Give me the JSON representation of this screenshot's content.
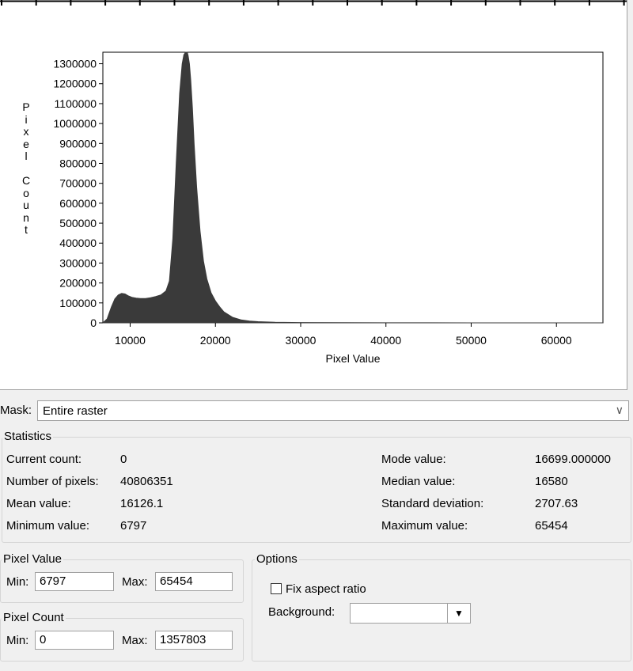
{
  "chart_data": {
    "type": "area",
    "title": "",
    "xlabel": "Pixel Value",
    "ylabel": "Pixel Count",
    "xlim": [
      6797,
      65454
    ],
    "ylim": [
      0,
      1357803
    ],
    "x_ticks": [
      "10000",
      "20000",
      "30000",
      "40000",
      "50000",
      "60000"
    ],
    "y_ticks": [
      "0",
      "100000",
      "200000",
      "300000",
      "400000",
      "500000",
      "600000",
      "700000",
      "800000",
      "900000",
      "1000000",
      "1100000",
      "1200000",
      "1300000"
    ],
    "series": [
      {
        "x": [
          6797,
          7300,
          7800,
          8200,
          8600,
          9000,
          9400,
          9800,
          10200,
          10700,
          11200,
          11800,
          12400,
          13000,
          13600,
          14200,
          14600,
          15000,
          15400,
          15800,
          16100,
          16300,
          16500,
          16600,
          16700,
          16800,
          16950,
          17100,
          17300,
          17500,
          17800,
          18200,
          18600,
          19000,
          19500,
          20000,
          20500,
          21000,
          22000,
          23000,
          24000,
          25000,
          27000,
          30000,
          35000,
          40000,
          45000,
          50000,
          55000,
          60000,
          65454
        ],
        "y": [
          0,
          20000,
          80000,
          120000,
          140000,
          148000,
          145000,
          135000,
          128000,
          124000,
          122000,
          122000,
          126000,
          132000,
          140000,
          160000,
          210000,
          420000,
          800000,
          1150000,
          1300000,
          1345000,
          1357803,
          1357803,
          1357803,
          1340000,
          1300000,
          1220000,
          1080000,
          900000,
          680000,
          460000,
          310000,
          220000,
          150000,
          110000,
          80000,
          55000,
          28000,
          15000,
          9000,
          6000,
          3000,
          1500,
          800,
          500,
          300,
          200,
          120,
          80,
          0
        ]
      }
    ]
  },
  "mask": {
    "label": "Mask:",
    "value": "Entire raster"
  },
  "statistics": {
    "title": "Statistics",
    "current_count": {
      "label": "Current count:",
      "value": "0"
    },
    "number_of_pixels": {
      "label": "Number of pixels:",
      "value": "40806351"
    },
    "mean_value": {
      "label": "Mean value:",
      "value": "16126.1"
    },
    "minimum_value": {
      "label": "Minimum value:",
      "value": "6797"
    },
    "mode_value": {
      "label": "Mode value:",
      "value": "16699.000000"
    },
    "median_value": {
      "label": "Median value:",
      "value": "16580"
    },
    "standard_deviation": {
      "label": "Standard deviation:",
      "value": "2707.63"
    },
    "maximum_value": {
      "label": "Maximum value:",
      "value": "65454"
    }
  },
  "pixel_value": {
    "title": "Pixel Value",
    "min_label": "Min:",
    "min": "6797",
    "max_label": "Max:",
    "max": "65454"
  },
  "pixel_count": {
    "title": "Pixel Count",
    "min_label": "Min:",
    "min": "0",
    "max_label": "Max:",
    "max": "1357803"
  },
  "options": {
    "title": "Options",
    "fix_aspect_label": "Fix aspect ratio",
    "fix_aspect_checked": false,
    "background_label": "Background:",
    "background_value": ""
  }
}
